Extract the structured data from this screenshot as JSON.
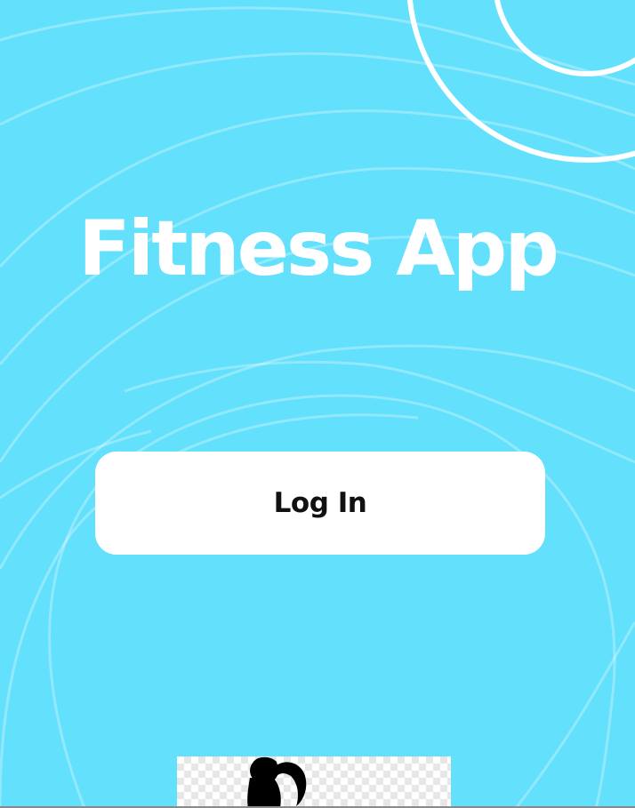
{
  "app": {
    "title": "Fitness App"
  },
  "actions": {
    "login_label": "Log In"
  },
  "colors": {
    "background": "#63E0FC",
    "button_background": "#FFFFFF",
    "title_text": "#FFFFFF",
    "button_text": "#111111"
  },
  "illustration": {
    "name": "person-illustration"
  }
}
